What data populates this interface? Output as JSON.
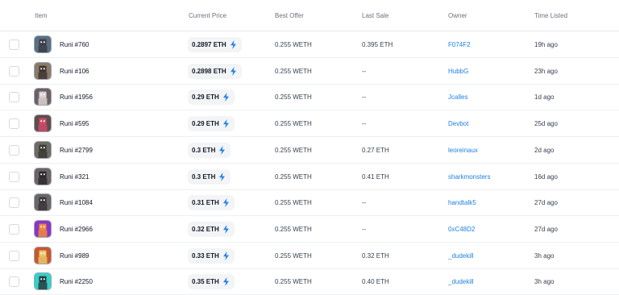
{
  "columns": [
    "Item",
    "Current Price",
    "Best Offer",
    "Last Sale",
    "Owner",
    "Time Listed"
  ],
  "colors": {
    "accent": "#2081e2",
    "bolt": "#2081e2"
  },
  "rows": [
    {
      "name": "Runi #760",
      "price": "0.2897 ETH",
      "offer": "0.255 WETH",
      "last_sale": "0.395 ETH",
      "owner": "F074F2",
      "time": "19h ago",
      "avatar_bg": "#5b6f82",
      "avatar_fg": "#3b3f49"
    },
    {
      "name": "Runi #106",
      "price": "0.2898 ETH",
      "offer": "0.255 WETH",
      "last_sale": "--",
      "owner": "HubbG",
      "time": "23h ago",
      "avatar_bg": "#8c7a6a",
      "avatar_fg": "#403530"
    },
    {
      "name": "Runi #1956",
      "price": "0.29 ETH",
      "offer": "0.255 WETH",
      "last_sale": "--",
      "owner": "Jcalles",
      "time": "1d ago",
      "avatar_bg": "#6c5f66",
      "avatar_fg": "#d9d2cf"
    },
    {
      "name": "Runi #595",
      "price": "0.29 ETH",
      "offer": "0.255 WETH",
      "last_sale": "--",
      "owner": "Devbot",
      "time": "25d ago",
      "avatar_bg": "#5f4d4d",
      "avatar_fg": "#d04a6a"
    },
    {
      "name": "Runi #2799",
      "price": "0.3 ETH",
      "offer": "0.255 WETH",
      "last_sale": "0.27 ETH",
      "owner": "leoreinaux",
      "time": "2d ago",
      "avatar_bg": "#6e6b63",
      "avatar_fg": "#3d3a36"
    },
    {
      "name": "Runi #321",
      "price": "0.3 ETH",
      "offer": "0.255 WETH",
      "last_sale": "0.41 ETH",
      "owner": "sharkmonsters",
      "time": "16d ago",
      "avatar_bg": "#6d6468",
      "avatar_fg": "#2d2a2f"
    },
    {
      "name": "Runi #1084",
      "price": "0.31 ETH",
      "offer": "0.255 WETH",
      "last_sale": "--",
      "owner": "handtalk5",
      "time": "27d ago",
      "avatar_bg": "#6b6768",
      "avatar_fg": "#3b3738"
    },
    {
      "name": "Runi #2966",
      "price": "0.32 ETH",
      "offer": "0.255 WETH",
      "last_sale": "--",
      "owner": "0xC48D2",
      "time": "27d ago",
      "avatar_bg": "#8a34c9",
      "avatar_fg": "#f08a3a"
    },
    {
      "name": "Runi #989",
      "price": "0.33 ETH",
      "offer": "0.255 WETH",
      "last_sale": "0.32 ETH",
      "owner": "_dudekill",
      "time": "3h ago",
      "avatar_bg": "#c9562e",
      "avatar_fg": "#e8c66a"
    },
    {
      "name": "Runi #2250",
      "price": "0.35 ETH",
      "offer": "0.255 WETH",
      "last_sale": "0.40 ETH",
      "owner": "_dudekill",
      "time": "3h ago",
      "avatar_bg": "#2fd3c7",
      "avatar_fg": "#2b3b44"
    }
  ]
}
